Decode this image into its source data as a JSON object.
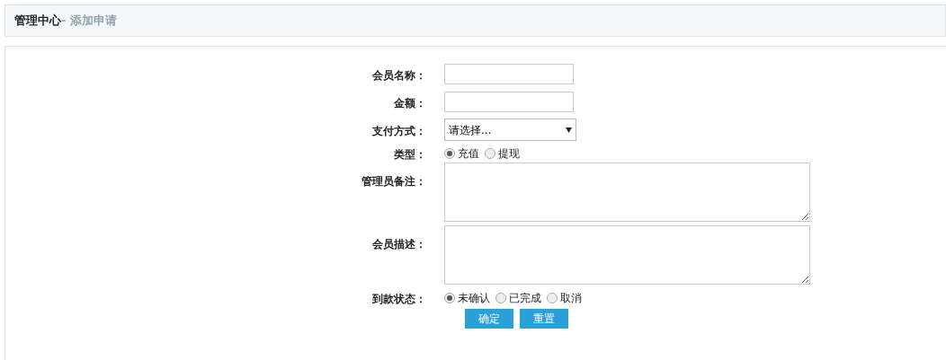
{
  "header": {
    "title": "管理中心",
    "subtitle": "- 添加申请"
  },
  "fields": [
    {
      "kind": "text",
      "label": "会员名称："
    },
    {
      "kind": "text",
      "label": "金额："
    },
    {
      "kind": "select",
      "label": "支付方式：",
      "value": "请选择..."
    },
    {
      "kind": "radio",
      "label": "类型：",
      "options": [
        {
          "label": "充值",
          "selected": true
        },
        {
          "label": "提现",
          "selected": false
        }
      ]
    },
    {
      "kind": "textarea",
      "label": "管理员备注："
    },
    {
      "kind": "textarea",
      "label": "会员描述："
    },
    {
      "kind": "radio",
      "label": "到款状态：",
      "options": [
        {
          "label": "未确认",
          "selected": true
        },
        {
          "label": "已完成",
          "selected": false
        },
        {
          "label": "取消",
          "selected": false
        }
      ]
    }
  ],
  "buttons": [
    "确定",
    "重置"
  ]
}
